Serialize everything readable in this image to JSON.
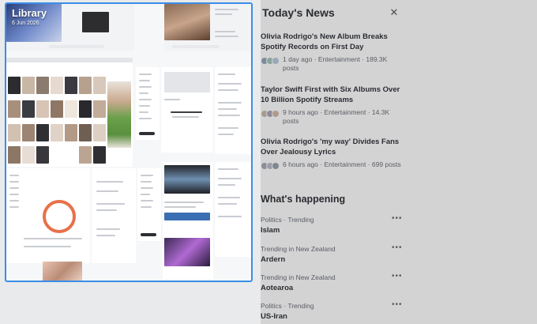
{
  "library": {
    "title": "Library",
    "date": "6 Jun 2026",
    "thumbnail_labels": [
      "Today's Forecast",
      "This account doesn't exist",
      "Who to follow",
      "What's happening"
    ]
  },
  "news": {
    "title": "Today's News",
    "close_icon": "close-icon",
    "stories": [
      {
        "headline": "Olivia Rodrigo's New Album Breaks Spotify Records on First Day",
        "meta": "1 day ago · Entertainment · 189.3K posts",
        "avatar_colors": [
          "#7a8c9a",
          "#8ba39a",
          "#9aa8b8"
        ]
      },
      {
        "headline": "Taylor Swift First with Six Albums Over 10 Billion Spotify Streams",
        "meta": "9 hours ago · Entertainment · 14.3K posts",
        "avatar_colors": [
          "#a89a8c",
          "#8c8a9a",
          "#b09a8a"
        ]
      },
      {
        "headline": "Olivia Rodrigo's 'my way' Divides Fans Over Jealousy Lyrics",
        "meta": "6 hours ago · Entertainment · 699 posts",
        "avatar_colors": [
          "#8a8d99",
          "#9d9ca6",
          "#7f8693"
        ]
      }
    ],
    "whats_happening": {
      "title": "What's happening",
      "trends": [
        {
          "category": "Politics · Trending",
          "name": "Islam"
        },
        {
          "category": "Trending in New Zealand",
          "name": "Ardern"
        },
        {
          "category": "Trending in New Zealand",
          "name": "Aotearoa"
        },
        {
          "category": "Politics · Trending",
          "name": "US-Iran"
        }
      ],
      "more_icon": "more-icon"
    }
  },
  "colors": {
    "selection_border": "#3a8ee6",
    "dim_panel": "#d3d3d4",
    "background": "#e9eaec"
  }
}
